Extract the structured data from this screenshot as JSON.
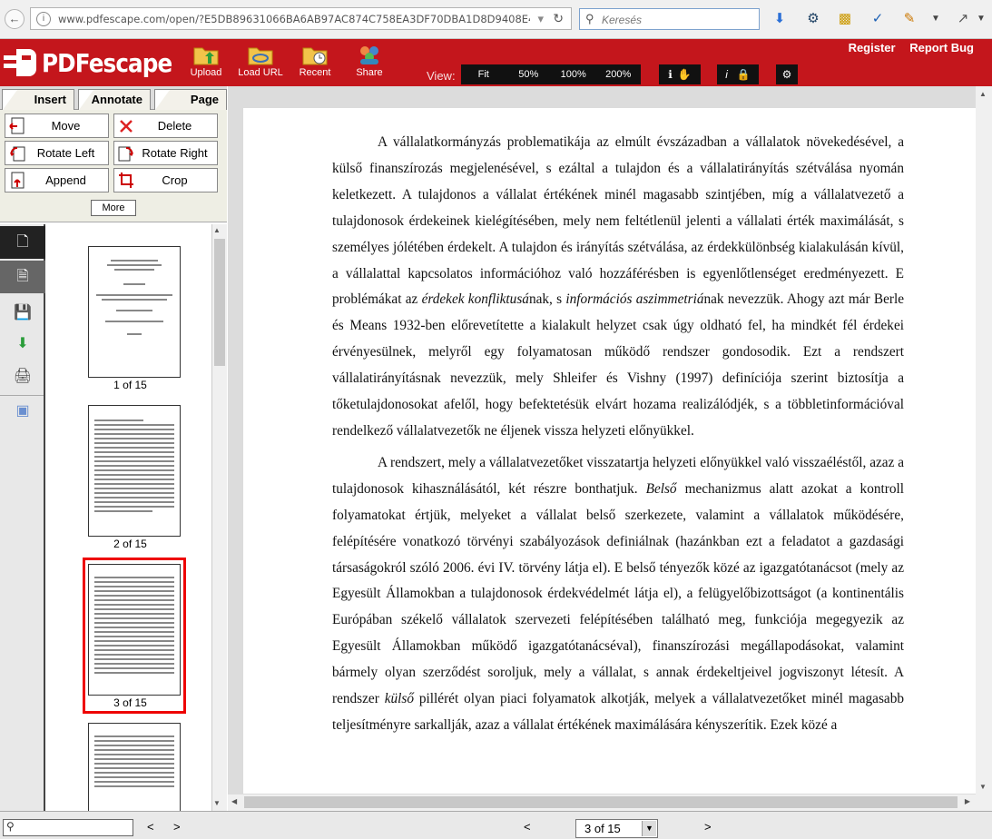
{
  "browser": {
    "url": "www.pdfescape.com/open/?E5DB89631066BA6AB97AC874C758EA3DF70DBA1D8D9408E4",
    "search_placeholder": "Keresés"
  },
  "app": {
    "logo": "PDFescape",
    "tools": [
      "Upload",
      "Load URL",
      "Recent",
      "Share"
    ],
    "view_label": "View:",
    "zoom_options": [
      "Fit",
      "50%",
      "100%",
      "200%"
    ],
    "user_links": [
      "Register",
      "Report Bug"
    ]
  },
  "left": {
    "tabs": [
      "Insert",
      "Annotate",
      "Page"
    ],
    "actions": [
      "Move",
      "Delete",
      "Rotate Left",
      "Rotate Right",
      "Append",
      "Crop"
    ],
    "more": "More",
    "thumbnails": [
      "1 of 15",
      "2 of 15",
      "3 of 15"
    ]
  },
  "document": {
    "paragraph1": "A vállalatkormányzás problematikája az elmúlt évszázadban a vállalatok növekedésével, a külső finanszírozás megjelenésével, s ezáltal a tulajdon és a vállalatirányítás szétválása nyomán keletkezett. A tulajdonos a vállalat értékének minél magasabb szintjében, míg a vállalatvezető a tulajdonosok érdekeinek kielégítésében, mely nem feltétlenül jelenti a vállalati érték maximálását, s személyes jólétében érdekelt. A tulajdon és irányítás szétválása, az érdekkülönbség kialakulásán kívül, a vállalattal kapcsolatos információhoz való hozzáférésben is egyenlőtlenséget eredményezett. E problémákat az",
    "p1_italic1": "érdekek konfliktusá",
    "p1_mid": "nak, s",
    "p1_italic2": "információs aszimmetriá",
    "p1_end": "nak nevezzük. Ahogy azt már Berle és Means 1932-ben előrevetítette a kialakult helyzet csak úgy oldható fel, ha mindkét fél érdekei érvényesülnek, melyről egy folyamatosan működő rendszer gondosodik. Ezt a rendszert vállalatirányításnak nevezzük, mely Shleifer és Vishny (1997) definíciója szerint biztosítja a tőketulajdonosokat afelől, hogy befektetésük elvárt hozama realizálódjék, s a többletinformációval rendelkező vállalatvezetők ne éljenek vissza helyzeti előnyükkel.",
    "paragraph2": "A rendszert, mely a vállalatvezetőket visszatartja helyzeti előnyükkel való visszaéléstől, azaz a tulajdonosok kihasználásától, két részre bonthatjuk.",
    "p2_italic1": "Belső",
    "p2_mid": "mechanizmus alatt azokat a kontroll folyamatokat értjük, melyeket a vállalat belső szerkezete, valamint a vállalatok működésére, felépítésére vonatkozó törvényi szabályozások definiálnak (hazánkban ezt a feladatot a gazdasági társaságokról szóló 2006. évi IV. törvény látja el). E belső tényezők közé az igazgatótanácsot (mely az Egyesült Államokban a tulajdonosok érdekvédelmét látja el), a felügyelőbizottságot (a kontinentális Európában székelő vállalatok szervezeti felépítésében található meg, funkciója megegyezik az Egyesült Államokban működő igazgatótanácséval), finanszírozási megállapodásokat, valamint bármely olyan szerződést soroljuk, mely a vállalat, s annak érdekeltjeivel jogviszonyt létesít. A rendszer",
    "p2_italic2": "külső",
    "p2_end": "pillérét olyan piaci folyamatok alkotják, melyek a vállalatvezetőket minél magasabb teljesítményre sarkallják, azaz a vállalat értékének maximálására kényszerítik. Ezek közé a"
  },
  "bottom": {
    "prev": "<",
    "next": ">",
    "page_select": "3 of 15"
  }
}
